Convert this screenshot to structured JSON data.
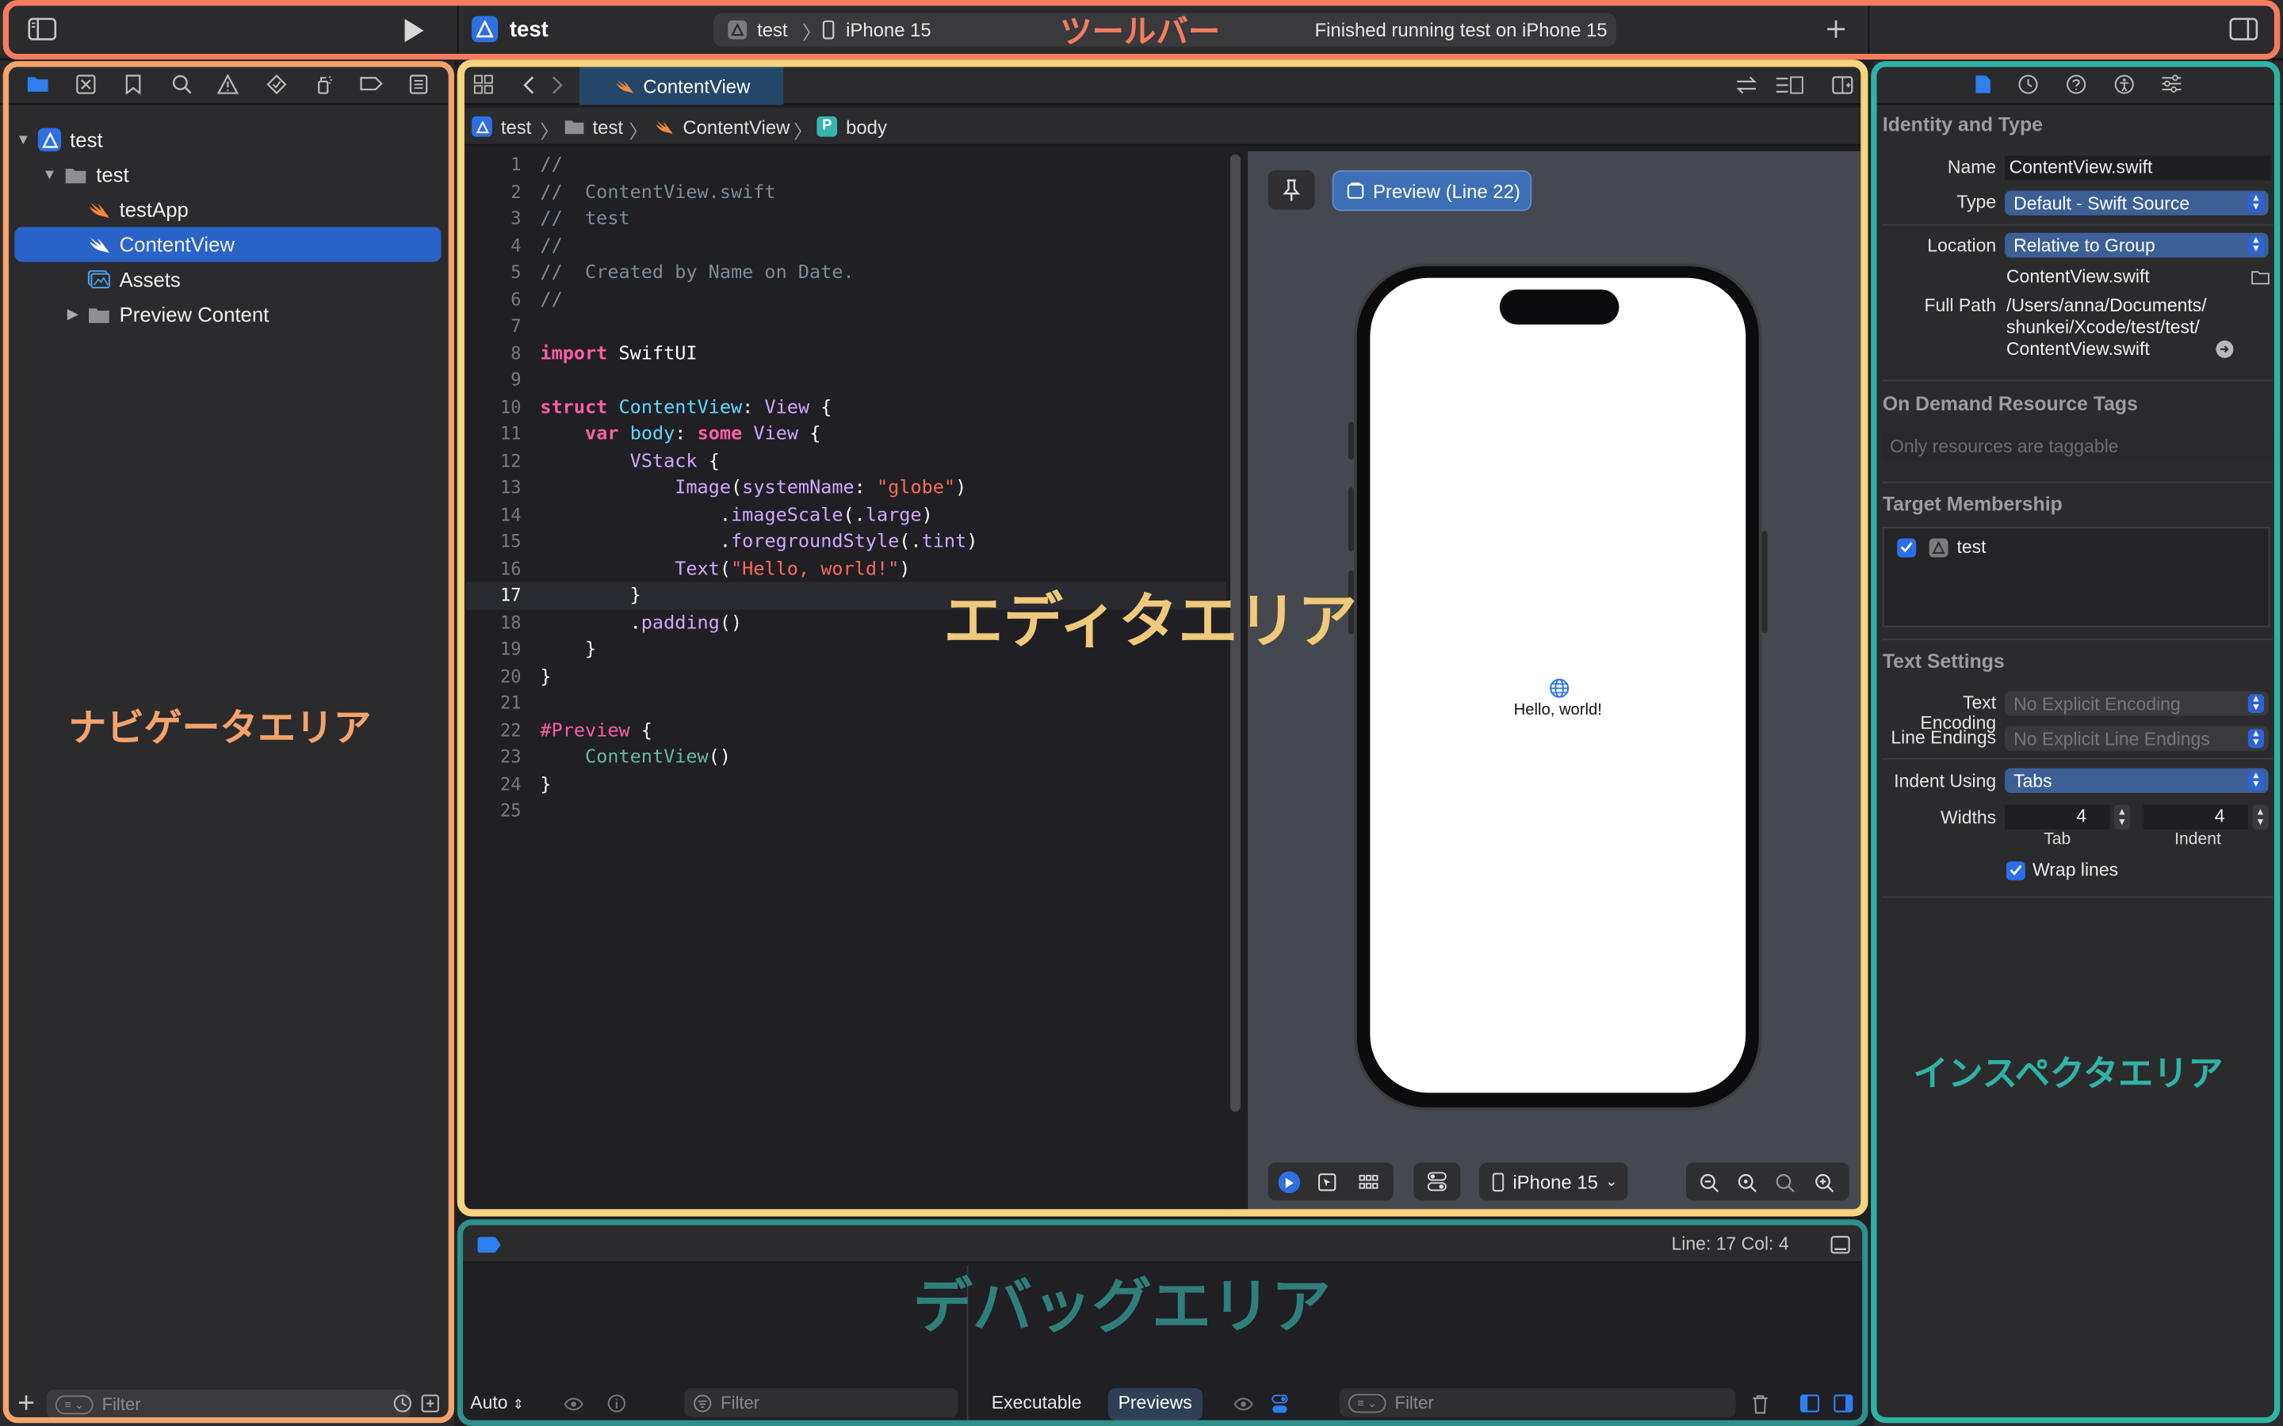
{
  "colors": {
    "toolbar_frame": "#f47c5f",
    "navigator_frame": "#f5a36a",
    "editor_frame": "#f7d47d",
    "debug_frame": "#2f8f8a",
    "inspector_frame": "#2fb3a5",
    "accent": "#2a63c8"
  },
  "annotations": {
    "toolbar": "ツールバー",
    "navigator": "ナビゲータエリア",
    "editor": "エディタエリア",
    "debug": "デバッグエリア",
    "inspector": "インスペクタエリア"
  },
  "toolbar": {
    "project": "test",
    "scheme": "test",
    "device": "iPhone 15",
    "status": "Finished running test on iPhone 15"
  },
  "navigator": {
    "items": [
      {
        "label": "test",
        "icon": "project-icon"
      },
      {
        "label": "test",
        "icon": "folder-icon"
      },
      {
        "label": "testApp",
        "icon": "swift-icon"
      },
      {
        "label": "ContentView",
        "icon": "swift-icon"
      },
      {
        "label": "Assets",
        "icon": "assets-icon"
      },
      {
        "label": "Preview Content",
        "icon": "folder-icon"
      }
    ],
    "filter_placeholder": "Filter"
  },
  "editor": {
    "tab": "ContentView",
    "breadcrumb": [
      "test",
      "test",
      "ContentView",
      "body"
    ],
    "current_line": 17,
    "line_numbers": [
      "1",
      "2",
      "3",
      "4",
      "5",
      "6",
      "7",
      "8",
      "9",
      "10",
      "11",
      "12",
      "13",
      "14",
      "15",
      "16",
      "17",
      "18",
      "19",
      "20",
      "21",
      "22",
      "23",
      "24",
      "25"
    ]
  },
  "canvas": {
    "preview_label": "Preview (Line 22)",
    "hello_text": "Hello, world!",
    "device": "iPhone 15"
  },
  "debug": {
    "status": "Line: 17  Col: 4",
    "auto": "Auto",
    "filter": "Filter",
    "executable": "Executable",
    "previews": "Previews",
    "filter2": "Filter"
  },
  "inspector": {
    "identity_title": "Identity and Type",
    "name_label": "Name",
    "name_value": "ContentView.swift",
    "type_label": "Type",
    "type_value": "Default - Swift Source",
    "location_label": "Location",
    "location_value": "Relative to Group",
    "location_file": "ContentView.swift",
    "fullpath_label": "Full Path",
    "fullpath_1": "/Users/anna/Documents/",
    "fullpath_2": "shunkei/Xcode/test/test/",
    "fullpath_3": "ContentView.swift",
    "ondemand_title": "On Demand Resource Tags",
    "ondemand_placeholder": "Only resources are taggable",
    "target_title": "Target Membership",
    "target_item": "test",
    "text_title": "Text Settings",
    "encoding_label": "Text Encoding",
    "encoding_value": "No Explicit Encoding",
    "endings_label": "Line Endings",
    "endings_value": "No Explicit Line Endings",
    "indent_label": "Indent Using",
    "indent_value": "Tabs",
    "widths_label": "Widths",
    "tab_width": "4",
    "indent_width": "4",
    "tab_caption": "Tab",
    "indent_caption": "Indent",
    "wrap_label": "Wrap lines"
  }
}
